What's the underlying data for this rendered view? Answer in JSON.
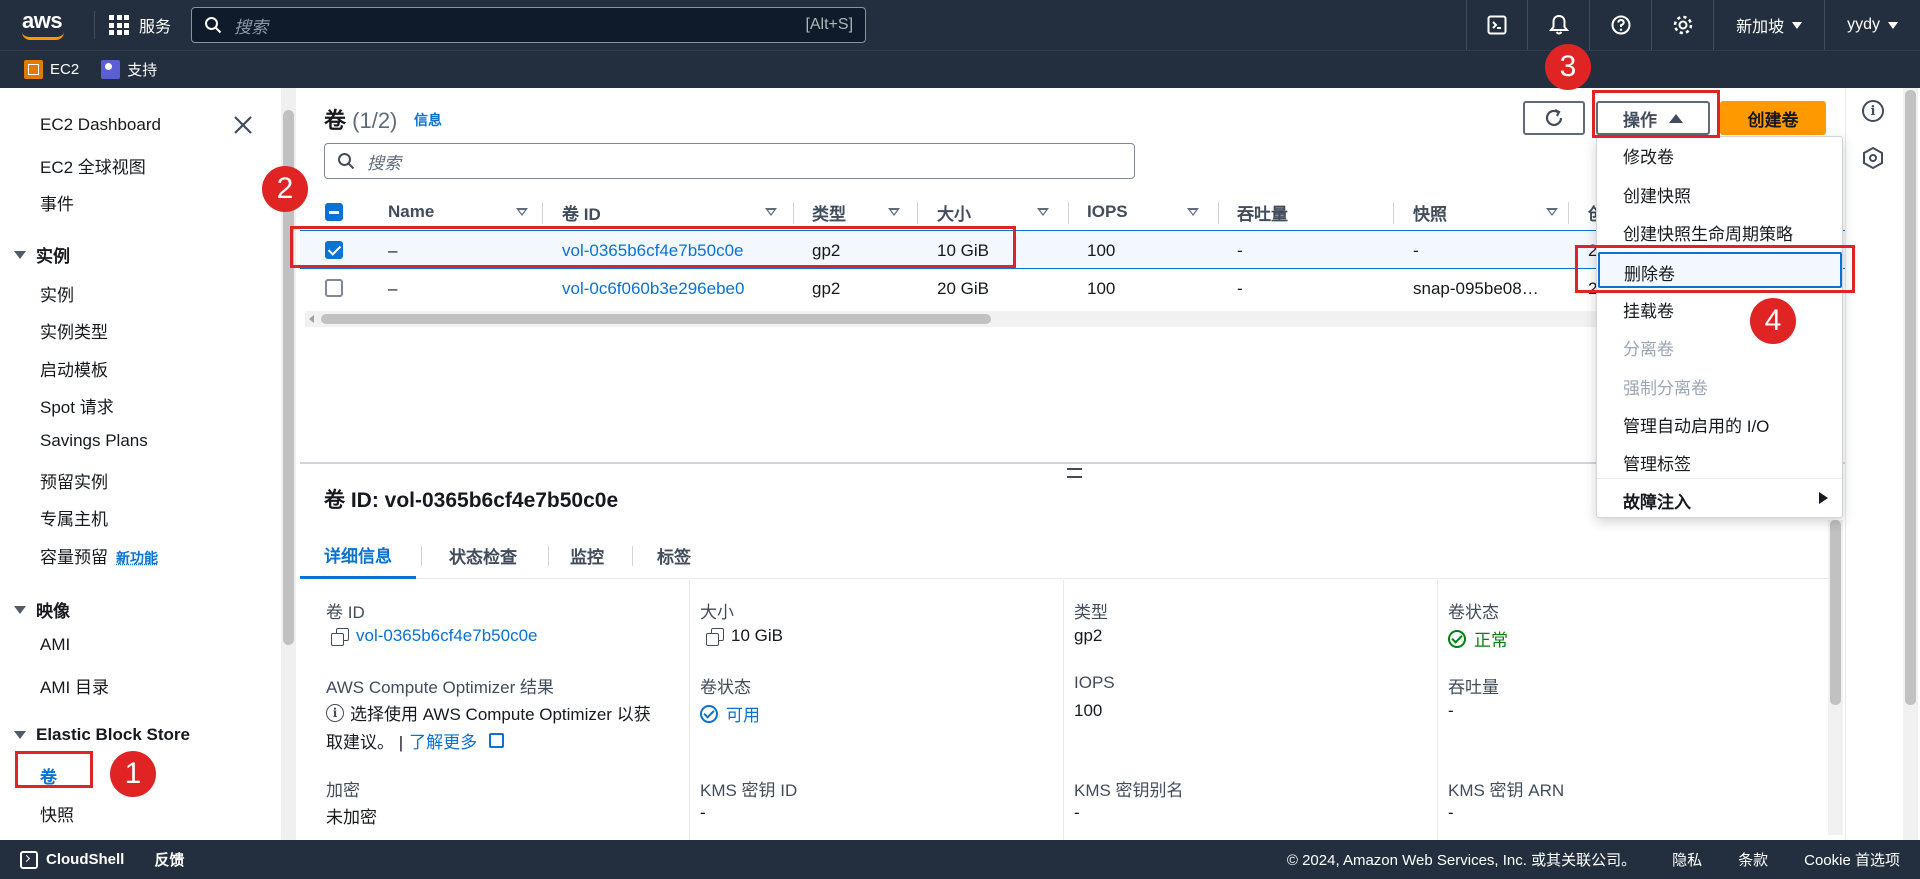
{
  "topnav": {
    "logo": "aws",
    "services": "服务",
    "search_placeholder": "搜索",
    "search_shortcut": "[Alt+S]",
    "region": "新加坡",
    "user": "yydy"
  },
  "subnav": {
    "ec2": "EC2",
    "support": "支持"
  },
  "sidebar": {
    "dashboard": "EC2 Dashboard",
    "global_view": "EC2 全球视图",
    "events": "事件",
    "sections": [
      {
        "title": "实例",
        "items": [
          "实例",
          "实例类型",
          "启动模板",
          "Spot 请求",
          "Savings Plans",
          "预留实例",
          "专属主机",
          "容量预留"
        ]
      },
      {
        "title": "映像",
        "items": [
          "AMI",
          "AMI 目录"
        ]
      },
      {
        "title": "Elastic Block Store",
        "items": [
          "卷",
          "快照"
        ]
      }
    ],
    "new_badge": "新功能"
  },
  "panel": {
    "title": "卷",
    "count": "(1/2)",
    "info": "信息",
    "search_placeholder": "搜索",
    "actions": "操作",
    "create": "创建卷"
  },
  "table": {
    "columns": [
      "Name",
      "卷 ID",
      "类型",
      "大小",
      "IOPS",
      "吞吐量",
      "快照",
      "创"
    ],
    "rows": [
      {
        "name": "–",
        "id": "vol-0365b6cf4e7b50c0e",
        "type": "gp2",
        "size": "10 GiB",
        "iops": "100",
        "throughput": "-",
        "snapshot": "-",
        "extra": "2"
      },
      {
        "name": "–",
        "id": "vol-0c6f060b3e296ebe0",
        "type": "gp2",
        "size": "20 GiB",
        "iops": "100",
        "throughput": "-",
        "snapshot": "snap-095be08…",
        "extra": "2"
      }
    ]
  },
  "dropdown": {
    "items": [
      "修改卷",
      "创建快照",
      "创建快照生命周期策略",
      "删除卷",
      "挂载卷",
      "分离卷",
      "强制分离卷",
      "管理自动启用的 I/O",
      "管理标签",
      "故障注入"
    ]
  },
  "detail": {
    "title": "卷 ID: vol-0365b6cf4e7b50c0e",
    "tabs": [
      "详细信息",
      "状态检查",
      "监控",
      "标签"
    ],
    "fields": {
      "vol_id_label": "卷 ID",
      "vol_id": "vol-0365b6cf4e7b50c0e",
      "size_label": "大小",
      "size": "10 GiB",
      "type_label": "类型",
      "type": "gp2",
      "state_label": "卷状态",
      "state": "正常",
      "optimizer_label": "AWS Compute Optimizer 结果",
      "optimizer_text1": "选择使用 AWS Compute Optimizer 以获",
      "optimizer_text2": "取建议。 |",
      "learn_more": "了解更多",
      "vstate_label": "卷状态",
      "vstate": "可用",
      "iops_label": "IOPS",
      "iops": "100",
      "throughput_label": "吞吐量",
      "throughput": "-",
      "encrypt_label": "加密",
      "encrypt": "未加密",
      "kms_id_label": "KMS 密钥 ID",
      "kms_id": "-",
      "kms_alias_label": "KMS 密钥别名",
      "kms_alias": "-",
      "kms_arn_label": "KMS 密钥 ARN",
      "kms_arn": "-"
    }
  },
  "annotations": [
    "1",
    "2",
    "3",
    "4"
  ],
  "footer": {
    "cloudshell": "CloudShell",
    "feedback": "反馈",
    "copyright": "© 2024, Amazon Web Services, Inc. 或其关联公司。",
    "privacy": "隐私",
    "terms": "条款",
    "cookie": "Cookie 首选项"
  },
  "colors": {
    "accent": "#0972d3",
    "nav_bg": "#232f3e",
    "primary_btn": "#ff9900",
    "annotation": "#e02424",
    "success": "#037f0c"
  }
}
